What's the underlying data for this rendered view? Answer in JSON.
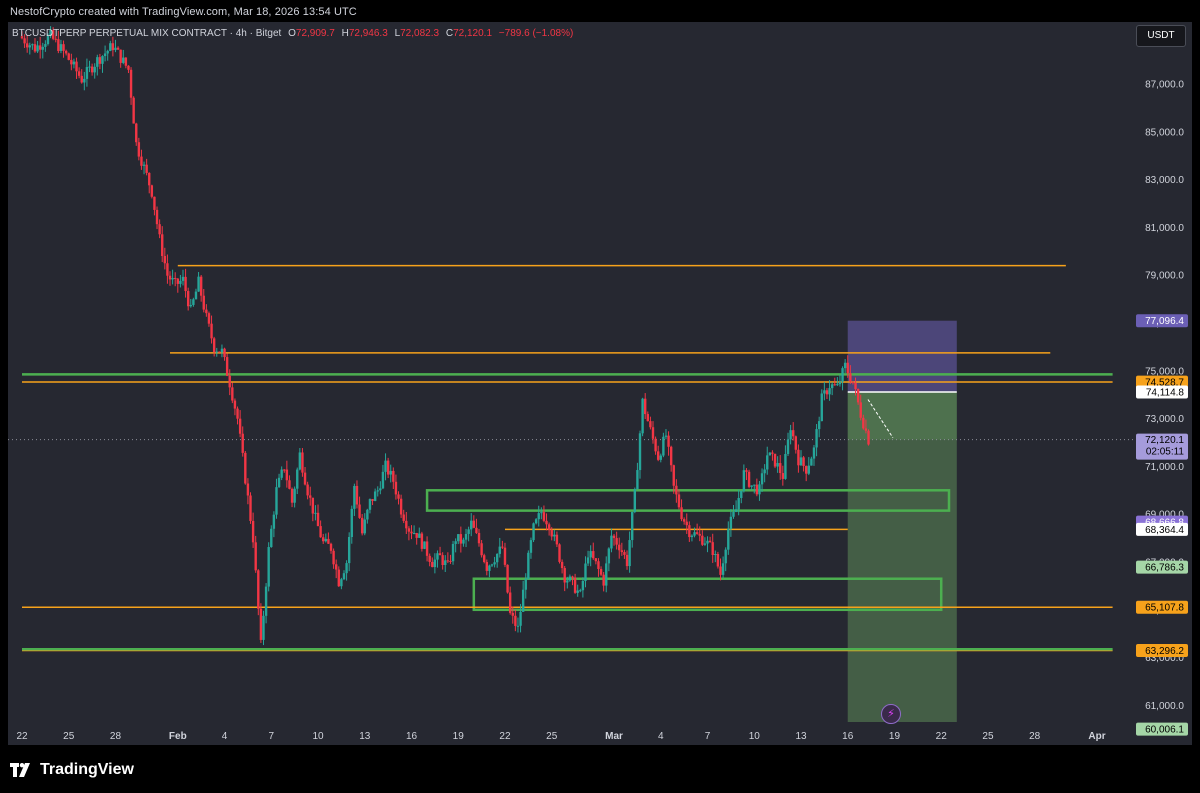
{
  "header": {
    "credit": "NestofCrypto created with TradingView.com, Mar 18, 2026 13:54 UTC"
  },
  "legend": {
    "symbol": "BTCUSDTPERP PERPETUAL MIX CONTRACT · 4h · Bitget",
    "open_label": "O",
    "open": "72,909.7",
    "high_label": "H",
    "high": "72,946.3",
    "low_label": "L",
    "low": "72,082.3",
    "close_label": "C",
    "close": "72,120.1",
    "change": "−789.6 (−1.08%)"
  },
  "currency_button": "USDT",
  "footer": {
    "brand": "TradingView"
  },
  "colors": {
    "up": "#26a69a",
    "down": "#f23645",
    "orange": "#f7a21b",
    "green_line": "#4caf50",
    "target_zone": "#5c8a58",
    "stop_zone": "#6b5fb5"
  },
  "icons": {
    "brand": "tradingview-logo-icon",
    "flash": "lightning-icon"
  },
  "chart_data": {
    "type": "candlestick",
    "symbol": "BTCUSDTPERP",
    "interval": "4h",
    "ylim": [
      59800,
      89200
    ],
    "y_ticks": [
      61000,
      63000,
      65000,
      67000,
      69000,
      71000,
      73000,
      75000,
      77000,
      79000,
      81000,
      83000,
      85000,
      87000
    ],
    "y_tick_labels": [
      "61,000.0",
      "63,000.0",
      "65,000.0",
      "67,000.0",
      "69,000.0",
      "71,000.0",
      "73,000.0",
      "75,000.0",
      "77,000.0",
      "79,000.0",
      "81,000.0",
      "83,000.0",
      "85,000.0",
      "87,000.0"
    ],
    "x_ticks": [
      {
        "day": 0,
        "label": "22"
      },
      {
        "day": 3,
        "label": "25"
      },
      {
        "day": 6,
        "label": "28"
      },
      {
        "day": 10,
        "label": "Feb"
      },
      {
        "day": 13,
        "label": "4"
      },
      {
        "day": 16,
        "label": "7"
      },
      {
        "day": 19,
        "label": "10"
      },
      {
        "day": 22,
        "label": "13"
      },
      {
        "day": 25,
        "label": "16"
      },
      {
        "day": 28,
        "label": "19"
      },
      {
        "day": 31,
        "label": "22"
      },
      {
        "day": 34,
        "label": "25"
      },
      {
        "day": 38,
        "label": "Mar"
      },
      {
        "day": 41,
        "label": "4"
      },
      {
        "day": 44,
        "label": "7"
      },
      {
        "day": 47,
        "label": "10"
      },
      {
        "day": 50,
        "label": "13"
      },
      {
        "day": 53,
        "label": "16"
      },
      {
        "day": 56,
        "label": "19"
      },
      {
        "day": 59,
        "label": "22"
      },
      {
        "day": 62,
        "label": "25"
      },
      {
        "day": 65,
        "label": "28"
      },
      {
        "day": 69,
        "label": "Apr"
      }
    ],
    "path_days": [
      0,
      1,
      2,
      3,
      4,
      5,
      6,
      7,
      7.5,
      8,
      8.5,
      9,
      9.5,
      10,
      10.5,
      11,
      11.5,
      12,
      12.5,
      13,
      13.5,
      14,
      14.5,
      15,
      15.5,
      16,
      16.5,
      17,
      17.5,
      18,
      18.5,
      19,
      19.5,
      20,
      20.5,
      21,
      21.5,
      22,
      22.5,
      23,
      23.5,
      24,
      24.5,
      25,
      25.5,
      26,
      26.5,
      27,
      27.5,
      28,
      28.5,
      29,
      29.5,
      30,
      30.5,
      31,
      31.5,
      32,
      32.5,
      33,
      33.5,
      34,
      34.5,
      35,
      35.5,
      36,
      36.5,
      37,
      37.5,
      38,
      38.5,
      39,
      39.5,
      40,
      40.5,
      41,
      41.5,
      42,
      42.5,
      43,
      43.5,
      44,
      44.5,
      45,
      45.5,
      46,
      46.5,
      47,
      47.5,
      48,
      48.5,
      49,
      49.5,
      50,
      50.5,
      51,
      51.5,
      52,
      52.5,
      53,
      53.5,
      54,
      54.5,
      55,
      55.5,
      56
    ],
    "path_prices": [
      89000,
      88500,
      89000,
      88200,
      87200,
      88000,
      88600,
      87600,
      84500,
      83500,
      82500,
      80500,
      79000,
      78600,
      78800,
      77500,
      78700,
      77200,
      76000,
      75800,
      74500,
      73000,
      70500,
      68000,
      63500,
      67500,
      70000,
      71000,
      69500,
      71500,
      70000,
      68800,
      67800,
      67600,
      66200,
      67000,
      70200,
      68200,
      69500,
      70000,
      71000,
      70400,
      69200,
      68400,
      68200,
      67600,
      67000,
      67200,
      66800,
      68000,
      67800,
      68600,
      67800,
      66800,
      67200,
      67600,
      64800,
      64200,
      66500,
      68400,
      69100,
      68600,
      67600,
      66400,
      66100,
      65600,
      67400,
      66900,
      66200,
      68100,
      67700,
      67000,
      69800,
      73700,
      72500,
      71400,
      72300,
      70100,
      69000,
      68300,
      68100,
      67900,
      67500,
      66500,
      68400,
      69200,
      70700,
      70200,
      70000,
      71500,
      71200,
      70600,
      72700,
      71300,
      70900,
      71700,
      73800,
      74400,
      74300,
      75200,
      74500,
      73200,
      72120
    ],
    "last_price": 72120.1,
    "countdown": "02:05:11",
    "horizontal_levels": [
      {
        "price": 79400,
        "start_day": 10,
        "end_day": 67,
        "color": "orange"
      },
      {
        "price": 75750,
        "start_day": 9.5,
        "end_day": 66,
        "color": "orange"
      },
      {
        "price": 74850,
        "start_day": 0,
        "end_day": 70,
        "color": "green"
      },
      {
        "price": 74529,
        "start_day": 0,
        "end_day": 70,
        "color": "orange"
      },
      {
        "price": 68364.4,
        "start_day": 31,
        "end_day": 53,
        "color": "orange"
      },
      {
        "price": 65107.8,
        "start_day": 0,
        "end_day": 70,
        "color": "orange"
      },
      {
        "price": 63296.2,
        "start_day": 0,
        "end_day": 70,
        "color": "orange"
      },
      {
        "price": 63350,
        "start_day": 0,
        "end_day": 70,
        "color": "green"
      }
    ],
    "zones": [
      {
        "day_start": 26,
        "day_end": 59.5,
        "price_top": 70000,
        "price_bottom": 69150
      },
      {
        "day_start": 29,
        "day_end": 59,
        "price_top": 66300,
        "price_bottom": 65000
      }
    ],
    "position": {
      "day_start": 53,
      "day_end": 60,
      "entry": 74114.8,
      "stop": 77096.4,
      "target": 60006.1
    },
    "price_labels": [
      {
        "price": 77096.4,
        "text": "77,096.4",
        "kind": "stop"
      },
      {
        "price": 74528.7,
        "text": "74,528.7",
        "kind": "orange"
      },
      {
        "price": 74114.8,
        "text": "74,114.8",
        "kind": "white"
      },
      {
        "price": 72120.1,
        "text": "72,120.1",
        "kind": "last"
      },
      {
        "price": 68666.8,
        "text": "68,666.8",
        "kind": "purple"
      },
      {
        "price": 68364.4,
        "text": "68,364.4",
        "kind": "white"
      },
      {
        "price": 66786.3,
        "text": "66,786.3",
        "kind": "target"
      },
      {
        "price": 65107.8,
        "text": "65,107.8",
        "kind": "orange"
      },
      {
        "price": 63296.2,
        "text": "63,296.2",
        "kind": "orange"
      },
      {
        "price": 60006.1,
        "text": "60,006.1",
        "kind": "target"
      }
    ]
  }
}
